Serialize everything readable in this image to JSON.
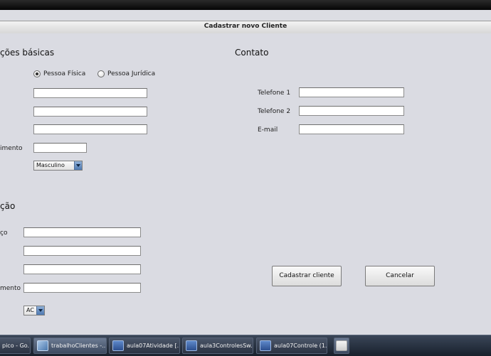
{
  "window": {
    "title": "Cadastrar novo Cliente"
  },
  "basic_info": {
    "heading": "ções  básicas",
    "person_type": {
      "options": [
        {
          "label": "Pessoa Física",
          "selected": true
        },
        {
          "label": "Pessoa Jurídica",
          "selected": false
        }
      ]
    },
    "fields": [
      {
        "label": "",
        "value": ""
      },
      {
        "label": "",
        "value": ""
      },
      {
        "label": "",
        "value": ""
      },
      {
        "label": "imento",
        "value": ""
      }
    ],
    "sex_select": {
      "value": "Masculino"
    }
  },
  "address": {
    "heading": "ção",
    "fields": [
      {
        "label": "ço",
        "value": ""
      },
      {
        "label": "",
        "value": ""
      },
      {
        "label": "",
        "value": ""
      },
      {
        "label": "mento",
        "value": ""
      }
    ],
    "state_select": {
      "value": "AC"
    }
  },
  "contact": {
    "heading": "Contato",
    "fields": [
      {
        "label": "Telefone  1",
        "value": ""
      },
      {
        "label": "Telefone  2",
        "value": ""
      },
      {
        "label": "E-mail",
        "value": ""
      }
    ]
  },
  "actions": {
    "submit_label": "Cadastrar cliente",
    "cancel_label": "Cancelar"
  },
  "taskbar": {
    "items": [
      {
        "label": "pico - Go...",
        "icon": "browser-icon"
      },
      {
        "label": "trabalhoClientes -...",
        "icon": "project-cube-icon"
      },
      {
        "label": "aula07Atividade [...",
        "icon": "word-document-icon"
      },
      {
        "label": "aula3ControlesSw...",
        "icon": "word-document-icon"
      },
      {
        "label": "aula07Controle (1...",
        "icon": "word-document-icon"
      },
      {
        "label": "",
        "icon": "java-icon"
      }
    ]
  }
}
